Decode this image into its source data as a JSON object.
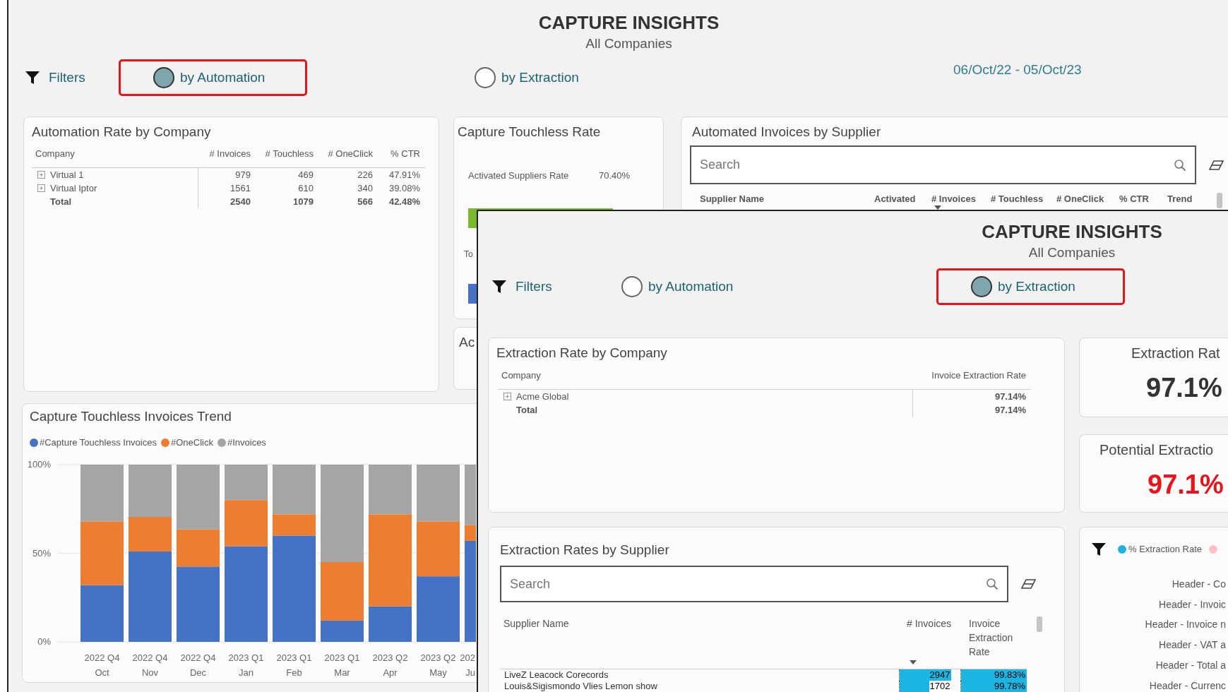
{
  "background_screen": {
    "title": "CAPTURE INSIGHTS",
    "subtitle": "All Companies",
    "filters_label": "Filters",
    "view_options": [
      {
        "label": "by Automation",
        "selected": true
      },
      {
        "label": "by Extraction",
        "selected": false
      }
    ],
    "date_range": "06/Oct/22 - 05/Oct/23",
    "automation_rate_by_company": {
      "title": "Automation Rate by Company",
      "columns": [
        "Company",
        "# Invoices",
        "# Touchless",
        "# OneClick",
        "% CTR"
      ],
      "rows": [
        {
          "kind": "group",
          "cells": [
            "Virtual 1",
            "979",
            "469",
            "226",
            "47.91%"
          ]
        },
        {
          "kind": "group",
          "cells": [
            "Virtual Iptor",
            "1561",
            "610",
            "340",
            "39.08%"
          ]
        },
        {
          "kind": "total",
          "cells": [
            "Total",
            "2540",
            "1079",
            "566",
            "42.48%"
          ]
        }
      ]
    },
    "capture_touchless_rate": {
      "title": "Capture Touchless Rate",
      "metric_label": "Activated Suppliers Rate",
      "metric_value": "70.40%",
      "second_label": "To"
    },
    "partial_panel": {
      "title": "Ac"
    },
    "automated_invoices_by_supplier": {
      "title": "Automated Invoices by Supplier",
      "search": {
        "placeholder": "Search"
      },
      "columns": [
        {
          "label": "Supplier Name",
          "sorted": false
        },
        {
          "label": "Activated",
          "sorted": false
        },
        {
          "label": "# Invoices",
          "sorted": true
        },
        {
          "label": "# Touchless",
          "sorted": false
        },
        {
          "label": "# OneClick",
          "sorted": false
        },
        {
          "label": "% CTR",
          "sorted": false
        },
        {
          "label": "Trend",
          "sorted": false
        }
      ]
    },
    "touchless_trend": {
      "title": "Capture Touchless Invoices Trend",
      "chart_data": {
        "type": "bar",
        "stacked": true,
        "categories": [
          "2022 Q4 Oct",
          "2022 Q4 Nov",
          "2022 Q4 Dec",
          "2023 Q1 Jan",
          "2023 Q1 Feb",
          "2023 Q1 Mar",
          "2023 Q2 Apr",
          "2023 Q2 May",
          "202 Ju"
        ],
        "series": [
          {
            "name": "#Capture Touchless Invoices",
            "color": "#4472c4",
            "values": [
              32,
              51,
              42.5,
              54,
              60,
              12,
              20,
              37,
              57
            ]
          },
          {
            "name": "#OneClick",
            "color": "#ed7d31",
            "values": [
              36,
              19.5,
              21,
              26,
              12,
              33,
              52,
              31,
              9
            ]
          },
          {
            "name": "#Invoices",
            "color": "#a5a5a5",
            "values": [
              32,
              29.5,
              36.5,
              20,
              28,
              55,
              28,
              32,
              34
            ]
          }
        ],
        "legend": true,
        "ylim": [
          0,
          100
        ],
        "yticks": [
          {
            "value": 0,
            "label": "0%"
          },
          {
            "value": 50,
            "label": "50%"
          },
          {
            "value": 100,
            "label": "100%"
          }
        ]
      }
    }
  },
  "foreground_screen": {
    "title": "CAPTURE INSIGHTS",
    "subtitle": "All Companies",
    "filters_label": "Filters",
    "view_options": [
      {
        "label": "by Automation",
        "selected": false
      },
      {
        "label": "by Extraction",
        "selected": true
      }
    ],
    "extraction_rate_by_company": {
      "title": "Extraction Rate by Company",
      "columns": [
        "Company",
        "Invoice Extraction Rate"
      ],
      "rows": [
        {
          "kind": "group",
          "cells": [
            "Acme Global",
            "97.14%"
          ]
        },
        {
          "kind": "total",
          "cells": [
            "Total",
            "97.14%"
          ]
        }
      ]
    },
    "extraction_rate_card": {
      "title": "Extraction Rat",
      "value": "97.1%",
      "alert": false
    },
    "potential_extraction_card": {
      "title": "Potential Extractio",
      "value": "97.1%",
      "alert": true
    },
    "extraction_rates_by_supplier": {
      "title": "Extraction Rates by Supplier",
      "search": {
        "placeholder": "Search"
      },
      "columns": [
        {
          "label": "Supplier Name",
          "sorted": false
        },
        {
          "label": "# Invoices",
          "sorted": true
        },
        {
          "label": "Invoice Extraction Rate",
          "sorted": false
        }
      ],
      "rows": [
        {
          "supplier": "LiveZ Leacock Corecords",
          "invoices": {
            "text": "2947",
            "level": 1
          },
          "rate": {
            "text": "99.83%",
            "level": 1
          }
        },
        {
          "supplier": "Louis&Sigismondo Vlies Lemon show",
          "invoices": {
            "text": "1702",
            "level": 0.58
          },
          "rate": {
            "text": "99.78%",
            "level": 1
          }
        }
      ]
    },
    "field_extraction_chart": {
      "legend": [
        {
          "label": "% Extraction Rate",
          "color": "#1cb4e0"
        },
        {
          "color": "#ffc0cb"
        }
      ],
      "labels": [
        "Header - Co",
        "Header - Invoic",
        "Header - Invoice n",
        "Header - VAT a",
        "Header - Total a",
        "Header - Currenc"
      ]
    }
  }
}
